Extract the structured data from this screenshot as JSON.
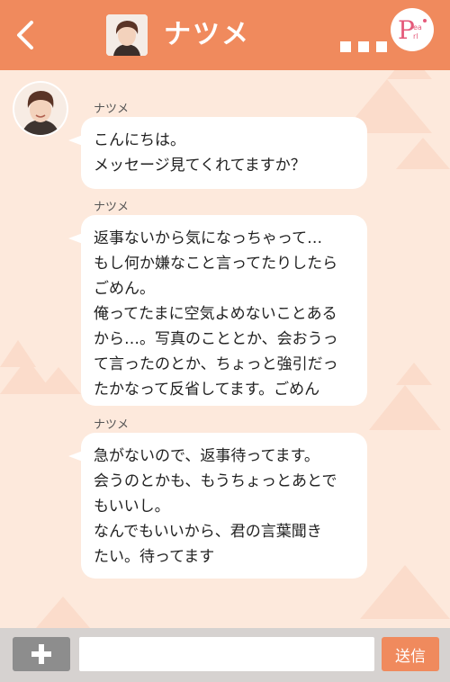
{
  "header": {
    "title": "ナツメ",
    "back_icon": "chevron-left-icon",
    "more_icon": "more-dots-icon",
    "logo_text": "Pearl"
  },
  "messages": [
    {
      "sender": "ナツメ",
      "text": "こんにちは。\nメッセージ見てくれてますか？"
    },
    {
      "sender": "ナツメ",
      "text": "返事ないから気になっちゃって…\nもし何か嫌なこと言ってたりしたら\nごめん。\n俺ってたまに空気よめないことある\nから…。写真のこととか、会おうっ\nて言ったのとか、ちょっと強引だっ\nたかなって反省してます。ごめん"
    },
    {
      "sender": "ナツメ",
      "text": "急がないので、返事待ってます。\n会うのとかも、もうちょっとあとで\nもいいし。\nなんでもいいから、君の言葉聞き\nたい。待ってます"
    }
  ],
  "footer": {
    "plus_icon": "plus-icon",
    "input_value": "",
    "input_placeholder": "",
    "send_label": "送信"
  },
  "colors": {
    "accent": "#f08a5d",
    "background": "#fde9dc",
    "footer": "#d6d2d0"
  }
}
